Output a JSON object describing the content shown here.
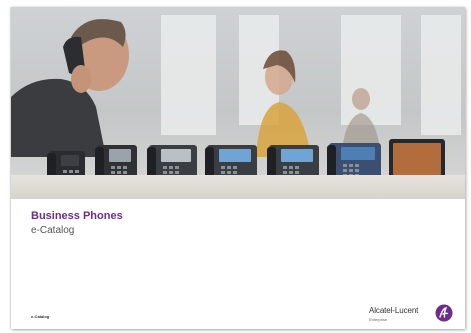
{
  "document": {
    "title": "Business Phones",
    "subtitle": "e-Catalog",
    "footer_label": "e-Catalog"
  },
  "brand": {
    "name": "Alcatel-Lucent",
    "sub": "Enterprise",
    "accent_color": "#6e2c8f"
  },
  "hero": {
    "phone_models": [
      {
        "style": "basic-deskphone"
      },
      {
        "style": "premium-deskphone"
      },
      {
        "style": "premium-deskphone-gray"
      },
      {
        "style": "premium-deskphone-color"
      },
      {
        "style": "premium-deskphone-color"
      },
      {
        "style": "premium-deskphone-dark"
      },
      {
        "style": "smart-deskphone"
      }
    ]
  }
}
